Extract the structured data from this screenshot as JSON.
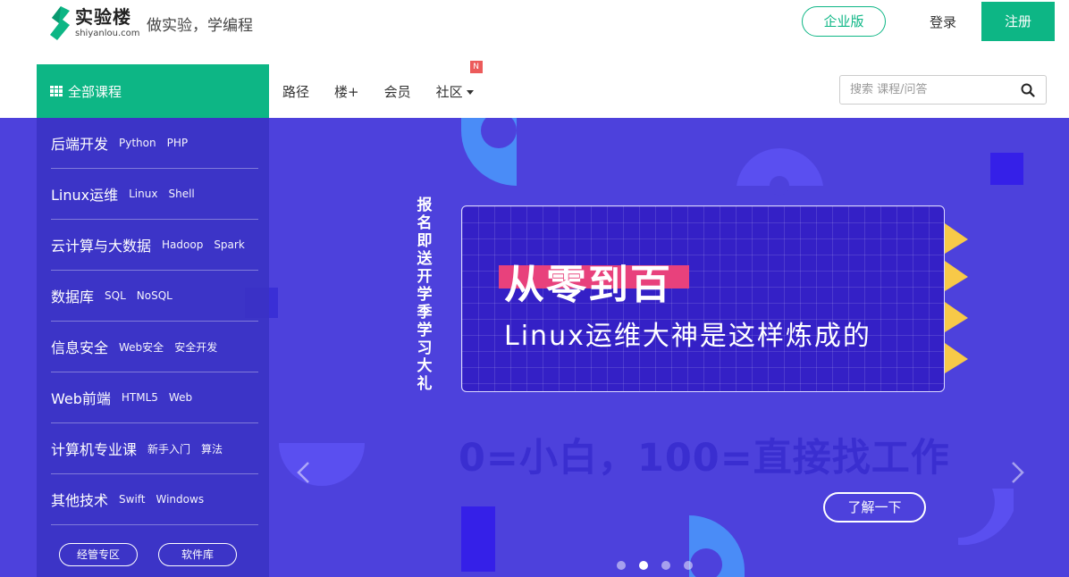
{
  "header": {
    "logo_cn": "实验楼",
    "logo_en": "shiyanlou.com",
    "slogan": "做实验，学编程",
    "enterprise_label": "企业版",
    "login_label": "登录",
    "register_label": "注册"
  },
  "nav": {
    "all_courses_label": "全部课程",
    "items": [
      {
        "label": "路径"
      },
      {
        "label": "楼+"
      },
      {
        "label": "会员"
      },
      {
        "label": "社区",
        "badge": "N"
      }
    ],
    "search_placeholder": "搜索 课程/问答"
  },
  "sidebar": {
    "categories": [
      {
        "label": "后端开发",
        "tags": [
          "Python",
          "PHP"
        ]
      },
      {
        "label": "Linux运维",
        "tags": [
          "Linux",
          "Shell"
        ]
      },
      {
        "label": "云计算与大数据",
        "tags": [
          "Hadoop",
          "Spark"
        ]
      },
      {
        "label": "数据库",
        "tags": [
          "SQL",
          "NoSQL"
        ]
      },
      {
        "label": "信息安全",
        "tags": [
          "Web安全",
          "安全开发"
        ]
      },
      {
        "label": "Web前端",
        "tags": [
          "HTML5",
          "Web"
        ]
      },
      {
        "label": "计算机专业课",
        "tags": [
          "新手入门",
          "算法"
        ]
      },
      {
        "label": "其他技术",
        "tags": [
          "Swift",
          "Windows"
        ]
      }
    ],
    "buttons": [
      "经管专区",
      "软件库"
    ]
  },
  "banner": {
    "vertical_text": "报名即送开学季学习大礼",
    "title": "从零到百",
    "subtitle": "Linux运维大神是这样炼成的",
    "tagline": "0=小白，100=直接找工作",
    "cta_label": "了解一下",
    "slides_count": 4,
    "active_slide": 2
  },
  "colors": {
    "brand_green": "#0db685",
    "banner_bg": "#4d41dc",
    "accent_pink": "#e8417c",
    "accent_yellow": "#f7c948"
  }
}
